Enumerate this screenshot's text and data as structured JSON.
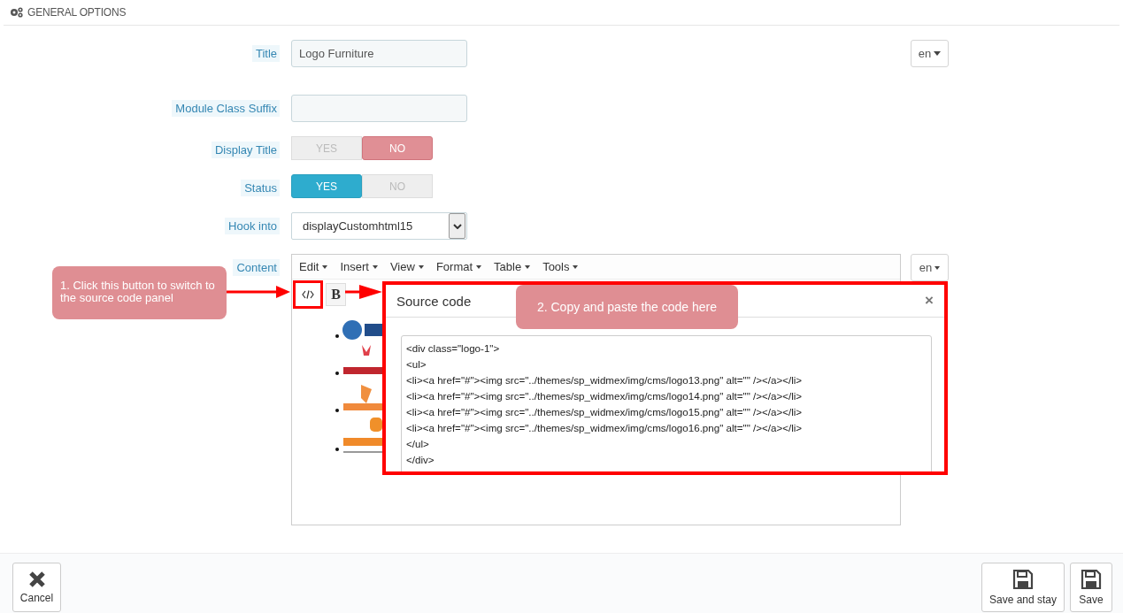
{
  "panel": {
    "title": "GENERAL OPTIONS"
  },
  "fields": [
    {
      "kind": "text",
      "label": "Title",
      "value": "Logo Furniture",
      "lang": "en"
    },
    {
      "kind": "text",
      "label": "Module Class Suffix"
    },
    {
      "kind": "toggle",
      "label": "Display Title",
      "options": [
        {
          "label": "YES",
          "selected": false
        },
        {
          "label": "NO",
          "selected": true
        }
      ]
    },
    {
      "kind": "toggle",
      "label": "Status",
      "options": [
        {
          "label": "YES",
          "selected": true
        },
        {
          "label": "NO",
          "selected": false
        }
      ]
    },
    {
      "kind": "select",
      "label": "Hook into",
      "value": "displayCustomhtml15"
    },
    {
      "kind": "editor",
      "label": "Content",
      "lang": "en",
      "menus": [
        "Edit",
        "Insert",
        "View",
        "Format",
        "Table",
        "Tools"
      ],
      "format_buttons": [
        "B"
      ]
    }
  ],
  "dialog": {
    "title": "Source code",
    "close": "×",
    "lines": [
      "<div class=\"logo-1\">",
      "<ul>",
      "<li><a href=\"#\"><img src=\"../themes/sp_widmex/img/cms/logo13.png\" alt=\"\" /></a></li>",
      "<li><a href=\"#\"><img src=\"../themes/sp_widmex/img/cms/logo14.png\" alt=\"\" /></a></li>",
      "<li><a href=\"#\"><img src=\"../themes/sp_widmex/img/cms/logo15.png\" alt=\"\" /></a></li>",
      "<li><a href=\"#\"><img src=\"../themes/sp_widmex/img/cms/logo16.png\" alt=\"\" /></a></li>",
      "</ul>",
      "</div>"
    ]
  },
  "callouts": [
    "1. Click this button to switch to the source code panel",
    "2. Copy and paste the code here"
  ],
  "footer": {
    "cancel": "Cancel",
    "save_and_stay": "Save and stay",
    "save": "Save"
  }
}
